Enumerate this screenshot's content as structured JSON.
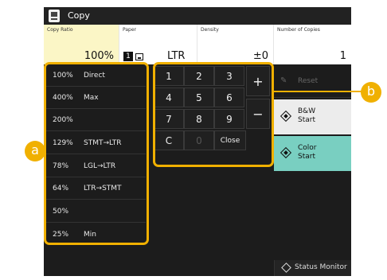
{
  "window": {
    "title": "Copy",
    "icon": "copy-icon"
  },
  "status": {
    "ratio_label": "Copy Ratio",
    "ratio_value": "100%",
    "paper_label": "Paper",
    "paper_tray": "1",
    "paper_value": "LTR",
    "density_label": "Density",
    "density_value": "±0",
    "copies_label": "Number of Copies",
    "copies_value": "1"
  },
  "ratio_list": [
    {
      "percent": "100%",
      "desc": "Direct"
    },
    {
      "percent": "400%",
      "desc": "Max"
    },
    {
      "percent": "200%",
      "desc": ""
    },
    {
      "percent": "129%",
      "desc": "STMT→LTR"
    },
    {
      "percent": "78%",
      "desc": "LGL→LTR"
    },
    {
      "percent": "64%",
      "desc": "LTR→STMT"
    },
    {
      "percent": "50%",
      "desc": ""
    },
    {
      "percent": "25%",
      "desc": "Min"
    }
  ],
  "keypad": {
    "keys": [
      "1",
      "2",
      "3",
      "4",
      "5",
      "6",
      "7",
      "8",
      "9"
    ],
    "plus": "+",
    "minus": "−",
    "clear": "C",
    "zero": "0",
    "close": "Close"
  },
  "right_panel": {
    "reset": "Reset",
    "bw_start": "B&W\nStart",
    "color_start": "Color\nStart"
  },
  "footer": {
    "status_monitor": "Status Monitor"
  },
  "callouts": {
    "a": "a",
    "b": "b"
  },
  "colors": {
    "accent": "#f0b000",
    "color_start": "#79cfc1",
    "ratio_highlight": "#fbf6c6"
  }
}
